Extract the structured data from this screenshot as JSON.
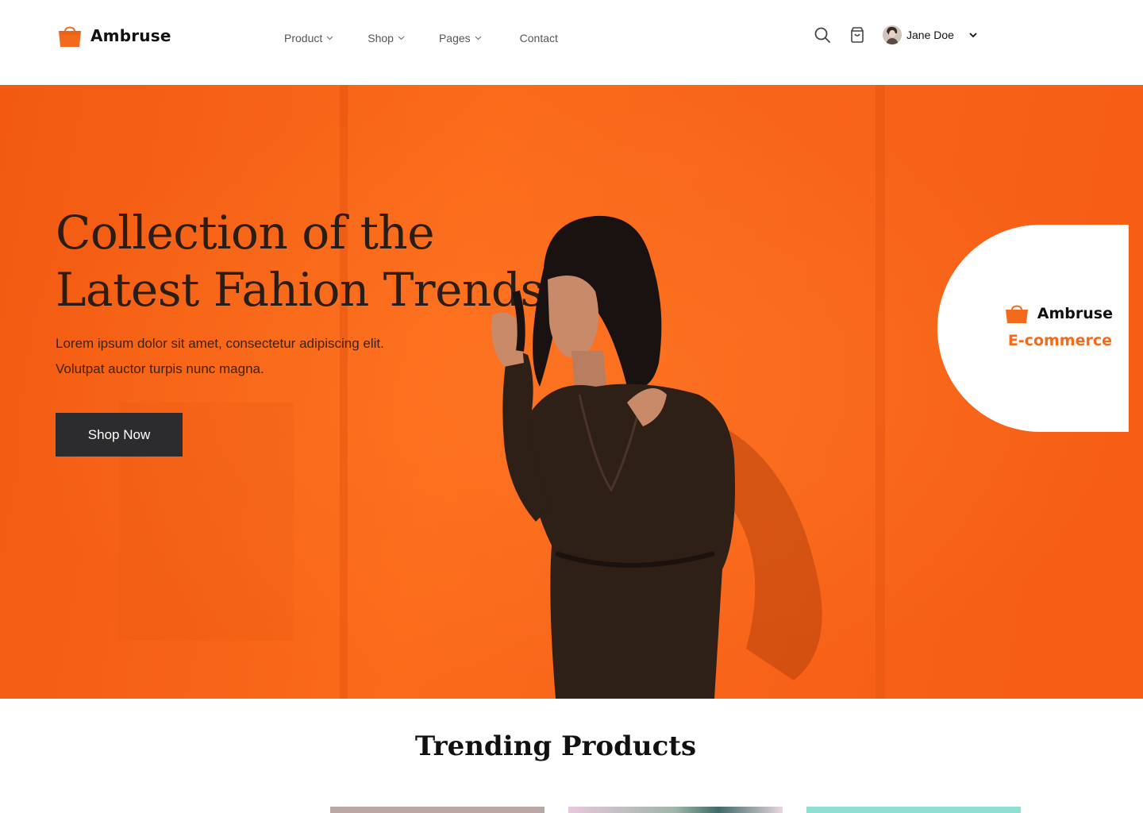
{
  "brand": {
    "name": "Ambruse",
    "accent": "#f46a1c"
  },
  "nav": {
    "items": [
      {
        "label": "Product",
        "has_dropdown": true
      },
      {
        "label": "Shop",
        "has_dropdown": true
      },
      {
        "label": "Pages",
        "has_dropdown": true
      },
      {
        "label": "Contact",
        "has_dropdown": false
      }
    ]
  },
  "header_tools": {
    "search_icon": "search-icon",
    "cart_icon": "shopping-bag-icon",
    "user": {
      "name": "Jane Doe",
      "menu_icon": "chevron-down-icon"
    }
  },
  "hero": {
    "title_line1": "Collection of the",
    "title_line2": "Latest Fahion Trends",
    "subtitle_line1": "Lorem ipsum dolor sit amet, consectetur adipiscing elit.",
    "subtitle_line2": "Volutpat auctor turpis nunc magna.",
    "cta_label": "Shop Now",
    "background_color": "#f8651a",
    "cta_color": "#2c2c2e"
  },
  "badge": {
    "brand_name": "Ambruse",
    "tagline": "E-commerce"
  },
  "trending": {
    "title": "Trending Products"
  }
}
